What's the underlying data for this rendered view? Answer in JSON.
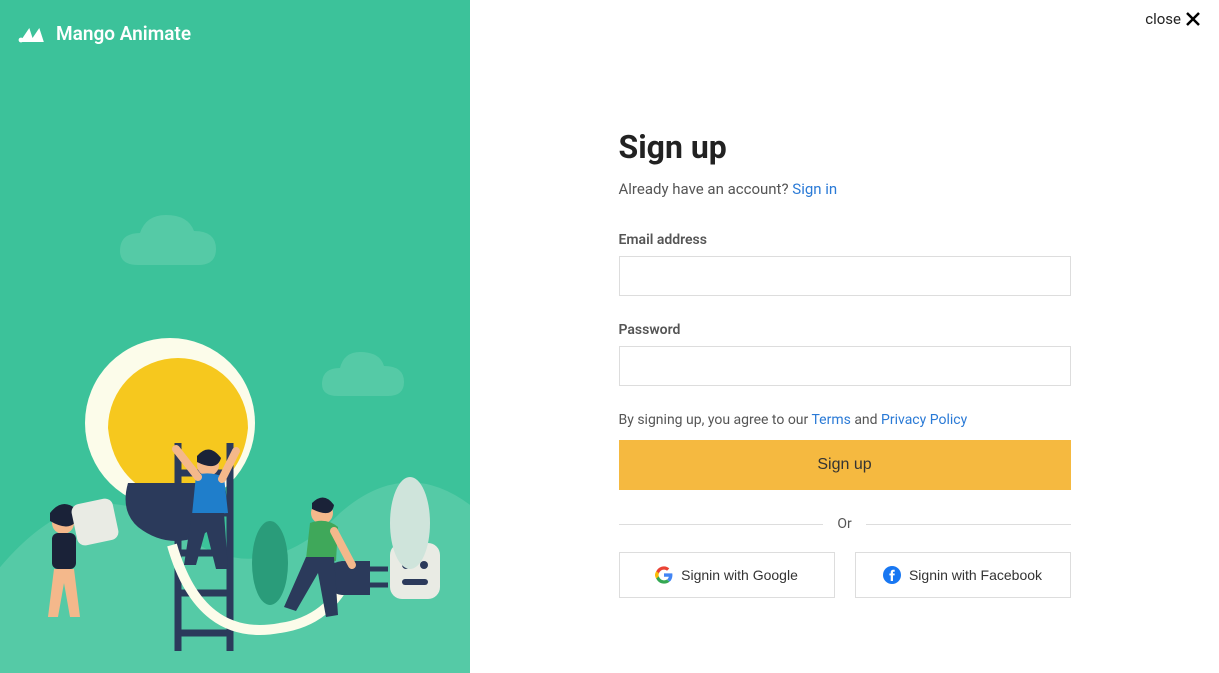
{
  "brand": {
    "name": "Mango Animate"
  },
  "close_label": "close",
  "form": {
    "title": "Sign up",
    "already_text": "Already have an account? ",
    "signin_link": "Sign in",
    "email_label": "Email address",
    "password_label": "Password",
    "agree_prefix": "By signing up, you agree to our ",
    "terms_link": "Terms",
    "agree_and": " and ",
    "privacy_link": "Privacy Policy",
    "submit_label": "Sign up",
    "divider_label": "Or",
    "google_label": "Signin with Google",
    "facebook_label": "Signin with Facebook"
  },
  "colors": {
    "accent_bg": "#3cc29a",
    "button_bg": "#f5b940",
    "link": "#2a7ad6"
  }
}
